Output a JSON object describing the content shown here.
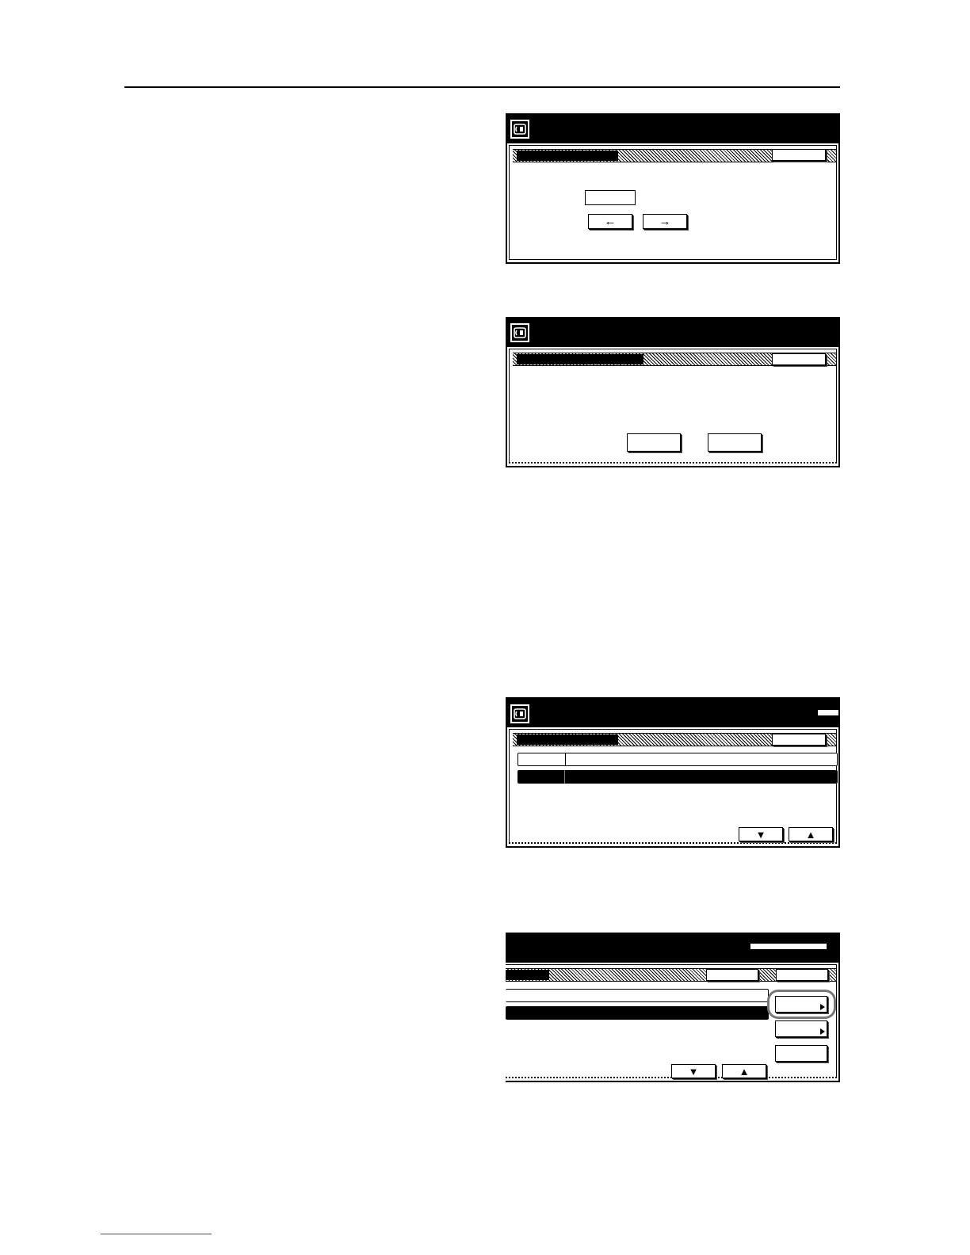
{
  "page": {
    "footer_link": ""
  },
  "screens": [
    {
      "id": "screen-1",
      "has_fax_icon": true,
      "controls": {
        "left_arrow": "←",
        "right_arrow": "→"
      }
    },
    {
      "id": "screen-2",
      "has_fax_icon": true
    },
    {
      "id": "screen-3",
      "has_fax_icon": true,
      "controls": {
        "scroll_down": "▼",
        "scroll_up": "▲"
      }
    },
    {
      "id": "screen-4",
      "has_fax_icon": false,
      "controls": {
        "scroll_down": "▼",
        "scroll_up": "▲"
      },
      "highlighted_button_index": 0
    }
  ],
  "colors": {
    "panel": "#000000",
    "background": "#ffffff",
    "highlight_ring": "#777777",
    "link": "#2a3fd1"
  },
  "icons": {
    "fax": "fax-machine-icon",
    "corner": "corner-arrow-icon"
  }
}
